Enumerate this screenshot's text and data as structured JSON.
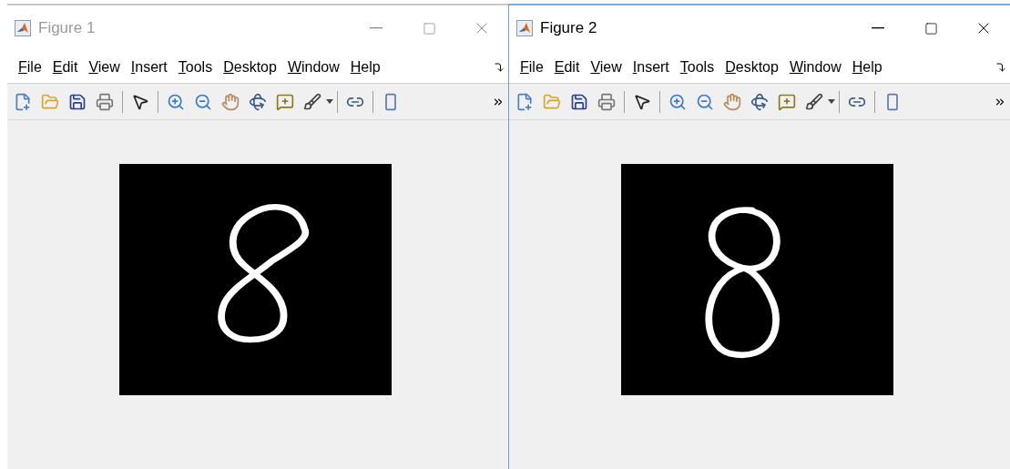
{
  "windows": [
    {
      "title": "Figure 1",
      "active": false,
      "menu": [
        "File",
        "Edit",
        "View",
        "Insert",
        "Tools",
        "Desktop",
        "Window",
        "Help"
      ]
    },
    {
      "title": "Figure 2",
      "active": true,
      "menu": [
        "File",
        "Edit",
        "View",
        "Insert",
        "Tools",
        "Desktop",
        "Window",
        "Help"
      ]
    }
  ]
}
